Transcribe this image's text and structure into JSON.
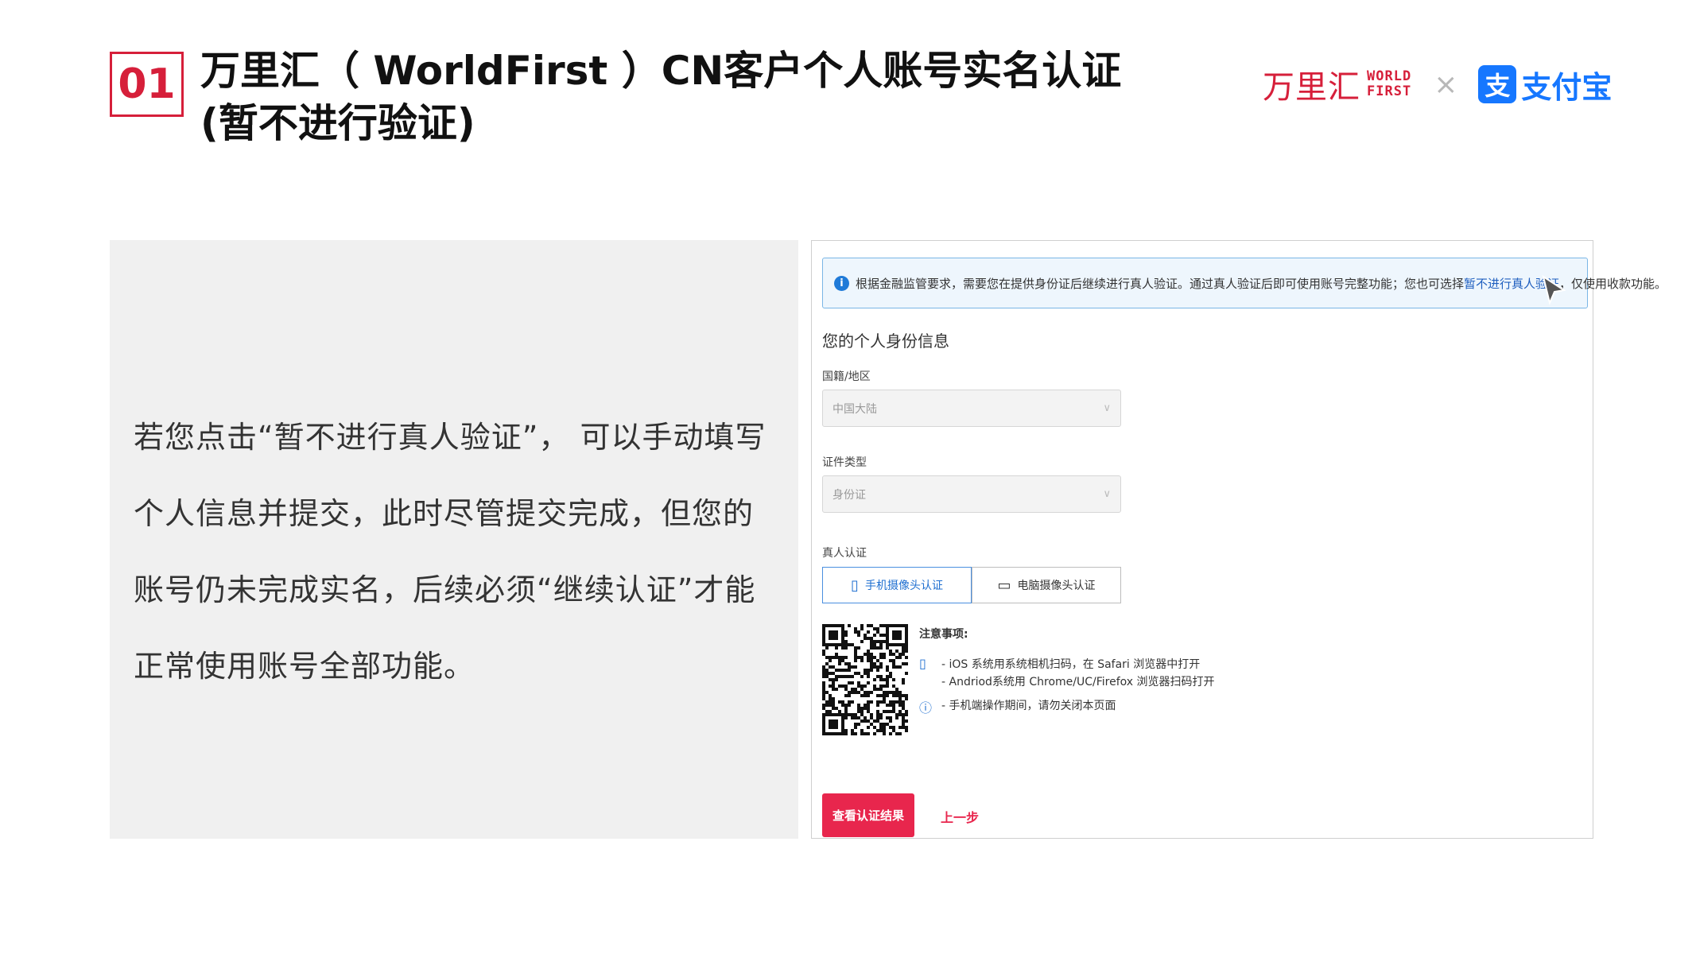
{
  "header": {
    "number": "01",
    "title_line1": "万里汇（ WorldFirst ）CN客户个人账号实名认证",
    "title_line2": "(暂不进行验证)"
  },
  "logos": {
    "worldfirst_cn": "万里汇",
    "worldfirst_en_line1": "WORLD",
    "worldfirst_en_line2": "FIRST",
    "separator": "×",
    "alipay_mark": "支",
    "alipay_text": "支付宝"
  },
  "left_panel": {
    "text": "若您点击“暂不进行真人验证”， 可以手动填写个人信息并提交，此时尽管提交完成，但您的账号仍未完成实名，后续必须“继续认证”才能正常使用账号全部功能。"
  },
  "screenshot": {
    "notice": {
      "text_before": "根据金融监管要求，需要您在提供身份证后继续进行真人验证。通过真人验证后即可使用账号完整功能；您也可选择 ",
      "link": "暂不进行真人验证",
      "text_after": "，仅使用收款功能。"
    },
    "section_title": "您的个人身份信息",
    "fields": {
      "nationality_label": "国籍/地区",
      "nationality_value": "中国大陆",
      "id_type_label": "证件类型",
      "id_type_value": "身份证",
      "auth_label": "真人认证"
    },
    "auth_options": {
      "mobile": "手机摄像头认证",
      "pc": "电脑摄像头认证"
    },
    "notes": {
      "title": "注意事项:",
      "line1": "- iOS 系统用系统相机扫码，在 Safari 浏览器中打开",
      "line2": "- Andriod系统用 Chrome/UC/Firefox 浏览器扫码打开",
      "line3": "- 手机端操作期间，请勿关闭本页面"
    },
    "buttons": {
      "view_result": "查看认证结果",
      "back": "上一步"
    }
  },
  "colors": {
    "brand_red": "#d61f3a",
    "alipay_blue": "#1677ff",
    "button_red": "#e8264d"
  }
}
